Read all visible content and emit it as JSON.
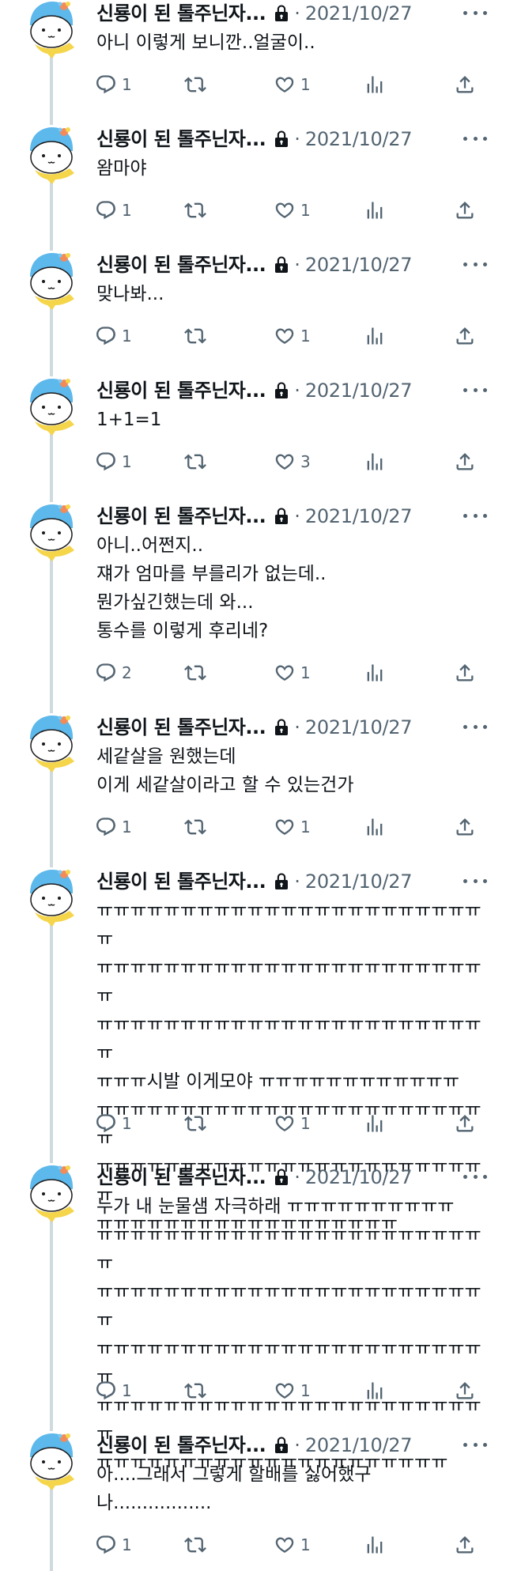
{
  "author": {
    "display_name": "신룡이 된 톨주닌자...",
    "date": "2021/10/27",
    "separator": "·"
  },
  "tweets": [
    {
      "text": "아니 이렇게 보니깐..얼굴이..",
      "replies": "1",
      "likes": "1"
    },
    {
      "text": "왐마야",
      "replies": "1",
      "likes": "1"
    },
    {
      "text": "맞나봐...",
      "replies": "1",
      "likes": "1"
    },
    {
      "text": "1+1=1",
      "replies": "1",
      "likes": "3"
    },
    {
      "text": "아니..어쩐지..\n쟤가 엄마를 부를리가 없는데..\n뭔가싶긴했는데 와...\n통수를 이렇게 후리네?",
      "replies": "2",
      "likes": "1"
    },
    {
      "text": "세같살을 원했는데\n이게 세같살이라고 할 수 있는건가",
      "replies": "1",
      "likes": "1"
    },
    {
      "text": "ㅠㅠㅠㅠㅠㅠㅠㅠㅠㅠㅠㅠㅠㅠㅠㅠㅠㅠㅠㅠㅠㅠㅠㅠ\nㅠㅠㅠㅠㅠㅠㅠㅠㅠㅠㅠㅠㅠㅠㅠㅠㅠㅠㅠㅠㅠㅠㅠㅠ\nㅠㅠㅠㅠㅠㅠㅠㅠㅠㅠㅠㅠㅠㅠㅠㅠㅠㅠㅠㅠㅠㅠㅠㅠ\nㅠㅠㅠ시발 이게모야 ㅠㅠㅠㅠㅠㅠㅠㅠㅠㅠㅠㅠ\nㅠㅠㅠㅠㅠㅠㅠㅠㅠㅠㅠㅠㅠㅠㅠㅠㅠㅠㅠㅠㅠㅠㅠㅠ\nㅠㅠㅠㅠㅠㅠㅠㅠㅠㅠㅠㅠㅠㅠㅠㅠㅠㅠㅠㅠㅠㅠㅠㅠ\nㅠㅠㅠㅠㅠㅠㅠㅠㅠㅠㅠㅠㅠㅠㅠㅠㅠㅠ",
      "replies": "1",
      "likes": "1"
    },
    {
      "text": "누가 내 눈물샘 자극하래 ㅠㅠㅠㅠㅠㅠㅠㅠㅠㅠ\nㅠㅠㅠㅠㅠㅠㅠㅠㅠㅠㅠㅠㅠㅠㅠㅠㅠㅠㅠㅠㅠㅠㅠㅠ\nㅠㅠㅠㅠㅠㅠㅠㅠㅠㅠㅠㅠㅠㅠㅠㅠㅠㅠㅠㅠㅠㅠㅠㅠ\nㅠㅠㅠㅠㅠㅠㅠㅠㅠㅠㅠㅠㅠㅠㅠㅠㅠㅠㅠㅠㅠㅠㅠㅠ\nㅠㅠㅠㅠㅠㅠㅠㅠㅠㅠㅠㅠㅠㅠㅠㅠㅠㅠㅠㅠㅠㅠㅠㅠ\nㅠㅠㅠㅠㅠㅠㅠㅠㅠㅠㅠㅠㅠㅠㅠㅠㅠㅠㅠㅠㅠ",
      "replies": "1",
      "likes": "1"
    },
    {
      "text": "아....그래서 그렇게 할배를 싫어했구\n나.................",
      "replies": "1",
      "likes": "1"
    }
  ],
  "icons": {
    "reply": "reply-icon",
    "retweet": "retweet-icon",
    "like": "heart-icon",
    "views": "views-icon",
    "share": "share-icon",
    "lock": "lock-icon",
    "more": "more-icon",
    "avatar": "mascot-avatar"
  },
  "colors": {
    "text": "#0f1419",
    "muted": "#536471",
    "thread_line": "#cfd9de",
    "avatar_blue": "#5db8ec",
    "scarf": "#f5d54a"
  }
}
